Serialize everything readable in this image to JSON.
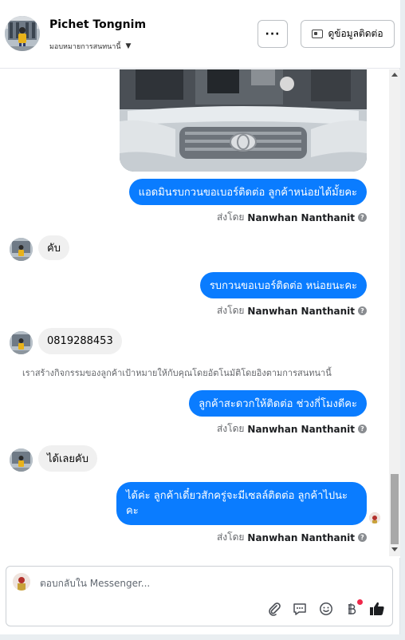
{
  "header": {
    "contact_name": "Pichet Tongnim",
    "assign_label": "มอบหมายการสนทนานี้",
    "more_label": "···",
    "contact_info_label": "ดูข้อมูลติดต่อ"
  },
  "messages": {
    "m1": "แอดมินรบกวนขอเบอร์ติดต่อ ลูกค้าหน่อยได้มั้ยคะ",
    "m2": "คับ",
    "m3": "รบกวนขอเบอร์ติดต่อ หน่อยนะคะ",
    "m4": "0819288453",
    "m5": "ลูกค้าสะดวกให้ติดต่อ ช่วงกี่โมงดีคะ",
    "m6": "ได้เลยคับ",
    "m7_line1": "ได้ค่ะ ลูกค้าเดี๋ยวสักครู่จะมีเซลล์ติดต่อ ลูกค้าไปนะ",
    "m7_line2": "คะ"
  },
  "sent_by": {
    "prefix": "ส่งโดย",
    "agent": "Nanwhan Nanthanit",
    "info_icon": "?"
  },
  "system_note": "เราสร้างกิจกรรมของลูกค้าเป้าหมายให้กับคุณโดยอัตโนมัติโดยอิงตามการสนทนานี้",
  "composer": {
    "placeholder": "ตอบกลับใน Messenger..."
  },
  "icons": [
    "attachment-icon",
    "saved-reply-icon",
    "emoji-icon",
    "baht-payment-icon",
    "like-icon",
    "help-icon",
    "card-icon",
    "caret-down-icon"
  ],
  "colors": {
    "outgoing_bubble": "#0a7cff",
    "incoming_bubble": "#f0f0f0",
    "like_icon": "#1c1e21",
    "notification_dot": "#f0284a"
  }
}
